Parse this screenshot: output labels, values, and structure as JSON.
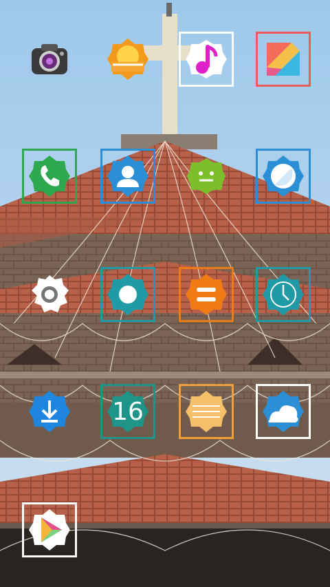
{
  "home_screen": {
    "apps": [
      {
        "name": "camera",
        "icon": "camera-icon"
      },
      {
        "name": "gallery",
        "icon": "gallery-sunrise-icon",
        "accent": "#f39a1c"
      },
      {
        "name": "music",
        "icon": "music-note-icon",
        "accent": "#e020c8"
      },
      {
        "name": "themes",
        "icon": "themes-icon"
      },
      {
        "name": "phone",
        "icon": "phone-icon",
        "accent": "#2da84f"
      },
      {
        "name": "contacts",
        "icon": "contact-person-icon",
        "accent": "#2b8fd6"
      },
      {
        "name": "android",
        "icon": "android-icon",
        "accent": "#7cbe2c"
      },
      {
        "name": "browser",
        "icon": "browser-icon",
        "accent": "#2b8fd6"
      },
      {
        "name": "settings",
        "icon": "gear-icon"
      },
      {
        "name": "record",
        "icon": "record-icon",
        "accent": "#1f9aa6"
      },
      {
        "name": "calculator",
        "icon": "calculator-equals-icon",
        "accent": "#f07a14"
      },
      {
        "name": "clock",
        "icon": "clock-icon",
        "accent": "#1f9aa6"
      },
      {
        "name": "downloads",
        "icon": "download-icon",
        "accent": "#1f86e0"
      },
      {
        "name": "calendar",
        "icon": "calendar-icon",
        "accent": "#1f9488",
        "day": "16"
      },
      {
        "name": "notes",
        "icon": "notes-icon",
        "accent": "#f2a03c"
      },
      {
        "name": "weather",
        "icon": "weather-cloud-icon",
        "accent": "#2b8fd6"
      },
      {
        "name": "play-store",
        "icon": "play-store-icon"
      }
    ]
  }
}
